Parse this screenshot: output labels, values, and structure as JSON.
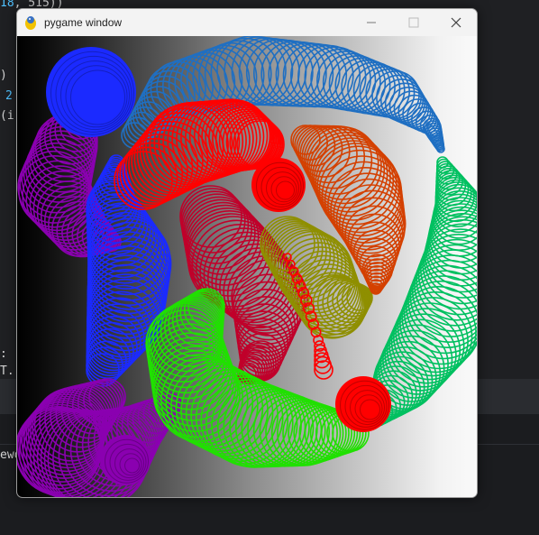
{
  "window": {
    "title": "pygame window",
    "app_icon": "pygame-snake-icon",
    "controls": [
      "minimize-icon",
      "maximize-icon",
      "close-icon"
    ]
  },
  "editor_fragments": [
    ")",
    ")",
    "2",
    "(i",
    ":",
    "T.",
    "ewo"
  ],
  "canvas": {
    "background": "horizontal black-to-white gradient",
    "trails": [
      {
        "color": "#1b2aff",
        "name": "blue"
      },
      {
        "color": "#1f6fc2",
        "name": "steel-blue"
      },
      {
        "color": "#ff0000",
        "name": "red"
      },
      {
        "color": "#d44000",
        "name": "orange"
      },
      {
        "color": "#8f8f00",
        "name": "olive"
      },
      {
        "color": "#00c060",
        "name": "green"
      },
      {
        "color": "#20e000",
        "name": "lime"
      },
      {
        "color": "#8a00b0",
        "name": "purple"
      },
      {
        "color": "#c0002a",
        "name": "crimson"
      }
    ]
  }
}
